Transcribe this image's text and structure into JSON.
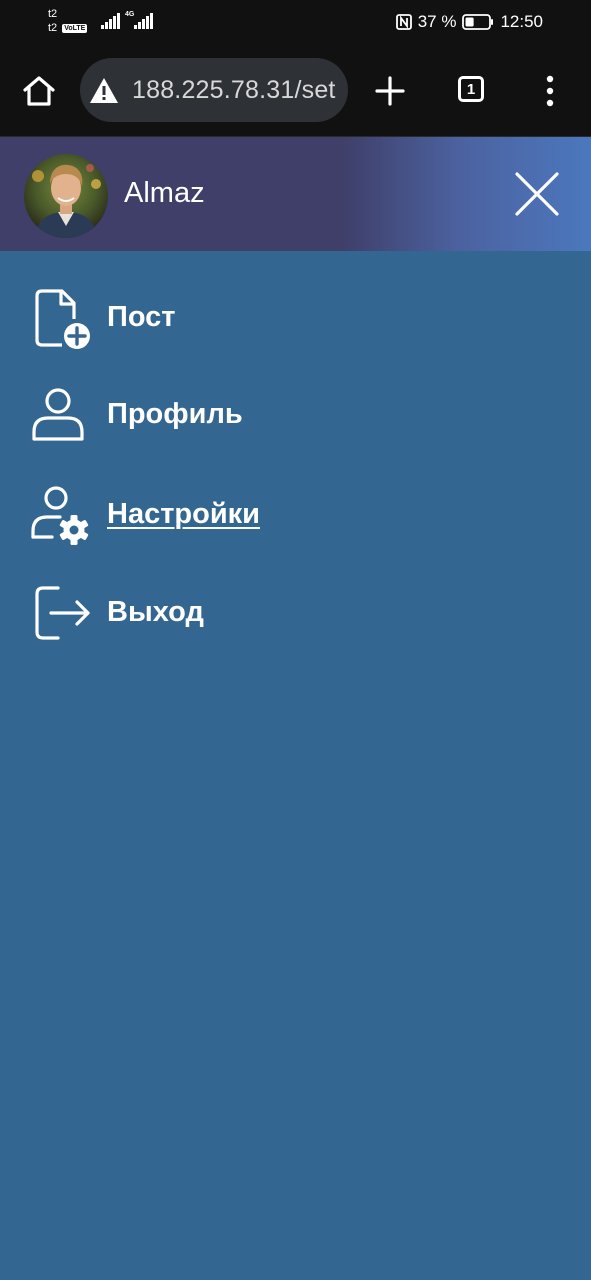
{
  "status_bar": {
    "carrier_1": "t2",
    "carrier_2": "t2",
    "volte": "VoLTE",
    "network_type": "4G",
    "battery_percent": "37 %",
    "battery_level": 0.37,
    "time": "12:50"
  },
  "browser": {
    "url": "188.225.78.31/set",
    "tab_count": "1",
    "icons": [
      "home-icon",
      "warning-icon",
      "plus-icon",
      "tabs-icon",
      "more-vert-icon"
    ]
  },
  "drawer": {
    "user_name": "Almaz",
    "header_gradient": [
      "#3f3f6a",
      "#4b78bd"
    ],
    "menu": [
      {
        "label": "Пост",
        "icon": "file-add-icon"
      },
      {
        "label": "Профиль",
        "icon": "user-icon"
      },
      {
        "label": "Настройки",
        "icon": "user-settings-icon",
        "active": true
      },
      {
        "label": "Выход",
        "icon": "logout-icon"
      }
    ]
  },
  "colors": {
    "background": "#336690",
    "status_bar": "#111111",
    "url_bar": "#2e3136",
    "text": "#ffffff"
  }
}
